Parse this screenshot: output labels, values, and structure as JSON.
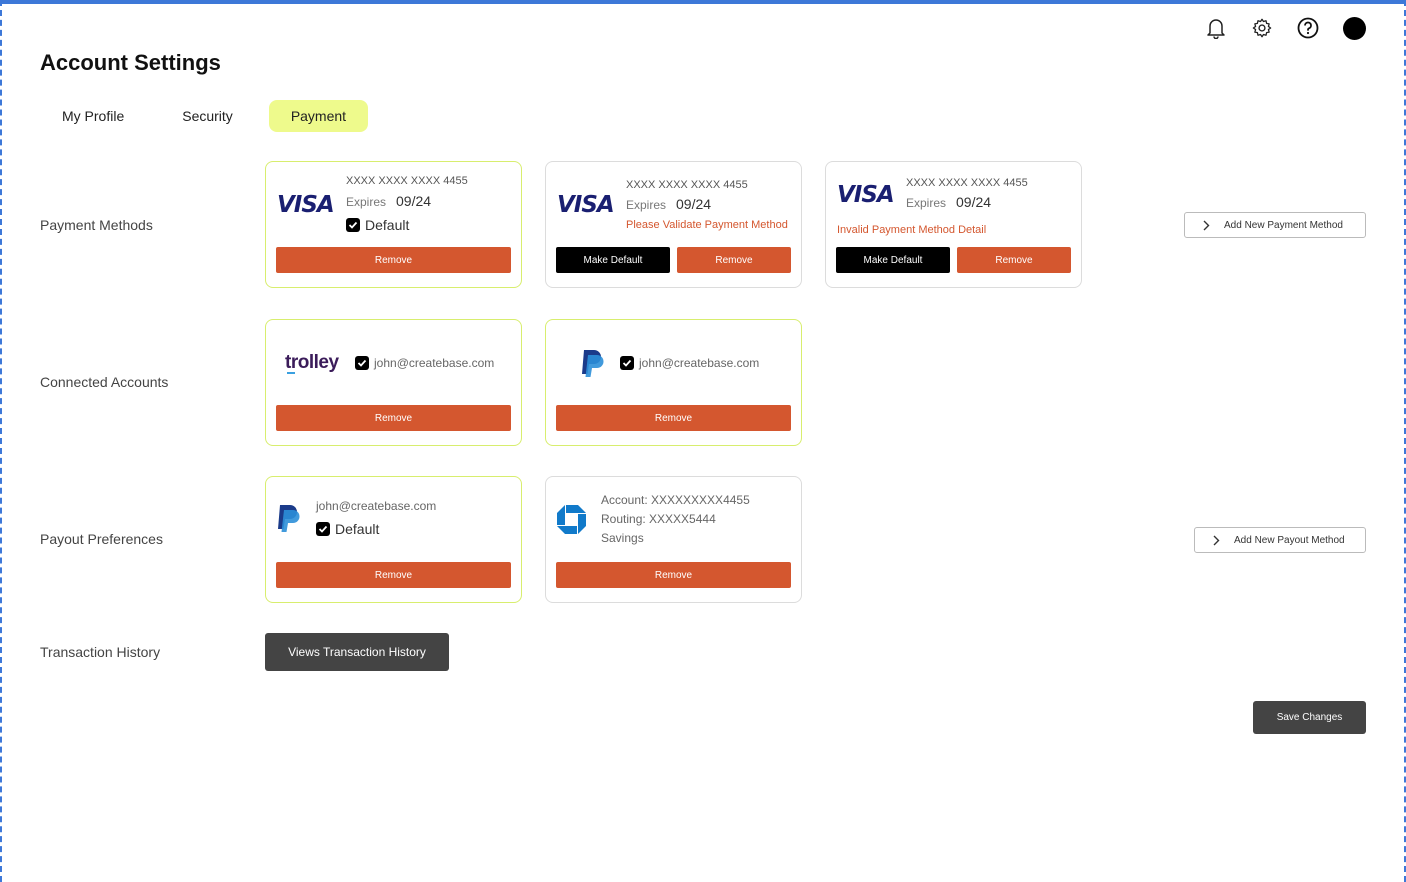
{
  "header": {
    "title": "Account Settings",
    "icons": [
      "bell-icon",
      "gear-icon",
      "help-icon",
      "avatar"
    ]
  },
  "tabs": [
    {
      "label": "My Profile",
      "active": false
    },
    {
      "label": "Security",
      "active": false
    },
    {
      "label": "Payment",
      "active": true
    }
  ],
  "sections": {
    "payment_methods": "Payment Methods",
    "connected_accounts": "Connected Accounts",
    "payout_preferences": "Payout Preferences",
    "transaction_history": "Transaction History"
  },
  "payment_cards": [
    {
      "brand": "VISA",
      "number": "XXXX XXXX XXXX 4455",
      "expires_label": "Expires",
      "expires": "09/24",
      "default_label": "Default",
      "remove": "Remove"
    },
    {
      "brand": "VISA",
      "number": "XXXX XXXX XXXX 4455",
      "expires_label": "Expires",
      "expires": "09/24",
      "warning": "Please Validate Payment Method",
      "make_default": "Make Default",
      "remove": "Remove"
    },
    {
      "brand": "VISA",
      "number": "XXXX XXXX XXXX 4455",
      "expires_label": "Expires",
      "expires": "09/24",
      "warning": "Invalid Payment Method Detail",
      "make_default": "Make Default",
      "remove": "Remove"
    }
  ],
  "add_payment_method": "Add New Payment Method",
  "connected": [
    {
      "brand": "trolley",
      "email": "john@createbase.com",
      "remove": "Remove"
    },
    {
      "brand": "paypal",
      "email": "john@createbase.com",
      "remove": "Remove"
    }
  ],
  "payouts": [
    {
      "brand": "paypal",
      "email": "john@createbase.com",
      "default_label": "Default",
      "remove": "Remove"
    },
    {
      "brand": "chase",
      "account": "Account: XXXXXXXXX4455",
      "routing": "Routing: XXXXX5444",
      "type": "Savings",
      "remove": "Remove"
    }
  ],
  "add_payout_method": "Add New Payout Method",
  "view_transactions": "Views Transaction History",
  "save_changes": "Save Changes",
  "colors": {
    "accent_tab": "#eefa8c",
    "remove": "#d4572f",
    "highlight_border": "#d8ee6e",
    "dark_button": "#444444",
    "visa_blue": "#1a1f71"
  }
}
